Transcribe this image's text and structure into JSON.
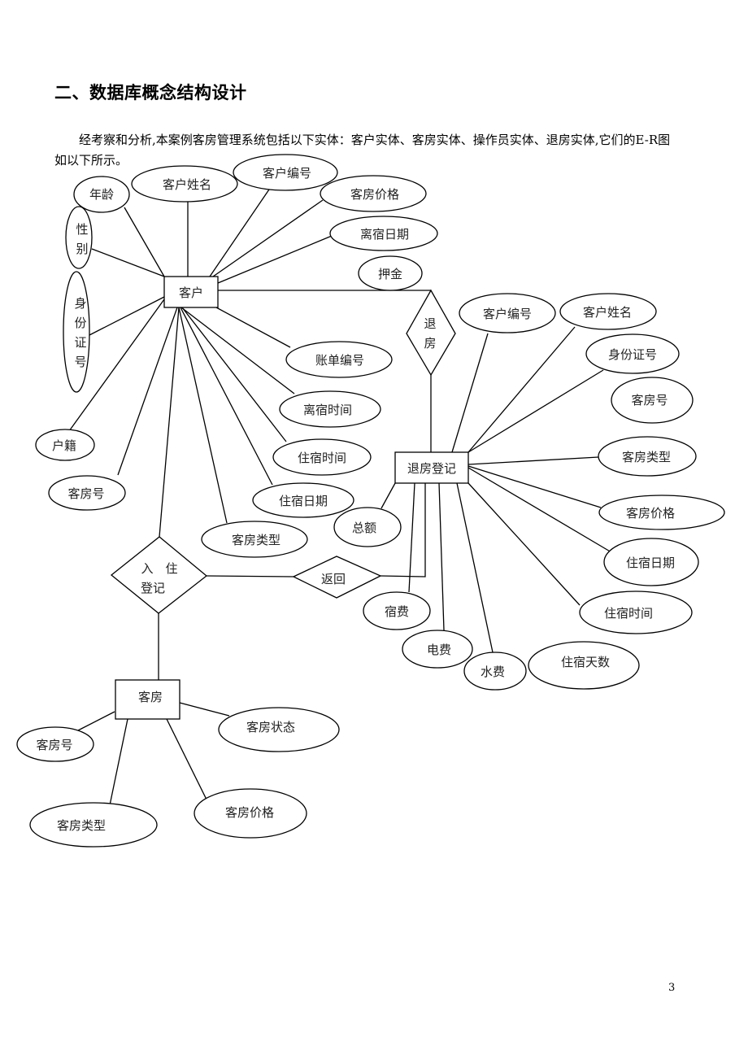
{
  "heading": "二、数据库概念结构设计",
  "paragraph": "经考察和分析,本案例客房管理系统包括以下实体：客户实体、客房实体、操作员实体、退房实体,它们的E-R图如以下所示。",
  "page_number": "3",
  "diagram": {
    "entities": {
      "customer": "客户",
      "checkout_record": "退房登记",
      "room": "客房"
    },
    "relationships": {
      "checkout": [
        "退",
        "房"
      ],
      "checkin": [
        "入　住",
        "登记"
      ],
      "return": "返回"
    },
    "customer_attributes": {
      "age": "年龄",
      "name": "客户姓名",
      "id": "客户编号",
      "room_price": "客房价格",
      "leave_date": "离宿日期",
      "deposit": "押金",
      "gender": [
        "性",
        "别"
      ],
      "id_card": [
        "身",
        "份",
        "证",
        "号"
      ],
      "bill_no": "账单编号",
      "leave_time": "离宿时间",
      "stay_time": "住宿时间",
      "stay_date": "住宿日期",
      "room_type": "客房类型",
      "room_no": "客房号",
      "household": "户籍"
    },
    "checkout_attributes": {
      "customer_id": "客户编号",
      "customer_name": "客户姓名",
      "id_card": "身份证号",
      "room_no": "客房号",
      "room_type": "客房类型",
      "room_price": "客房价格",
      "stay_date": "住宿日期",
      "stay_time": "住宿时间",
      "stay_days": "住宿天数",
      "water_fee": "水费",
      "electric_fee": "电费",
      "lodging_fee": "宿费",
      "total": "总额"
    },
    "room_attributes": {
      "room_no": "客房号",
      "room_status": "客房状态",
      "room_type": "客房类型",
      "room_price": "客房价格"
    }
  }
}
